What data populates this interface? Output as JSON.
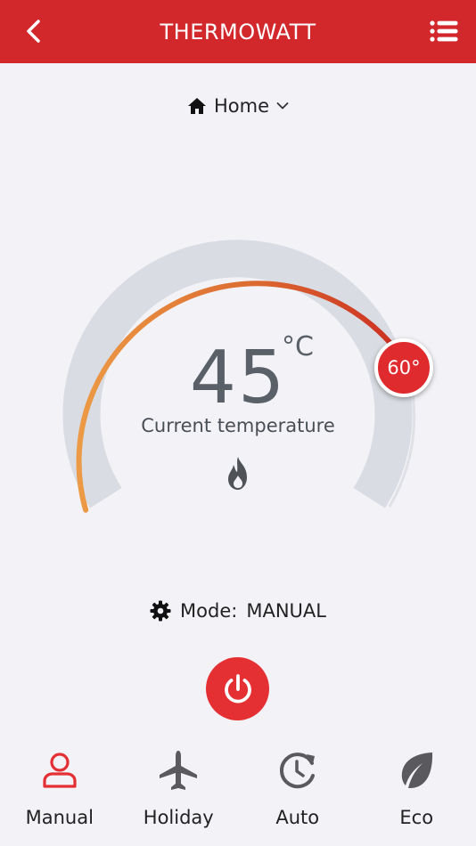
{
  "header": {
    "title": "THERMOWATT",
    "color": "#d2282c"
  },
  "location": {
    "name": "Home"
  },
  "gauge": {
    "current_temperature": "45",
    "unit": "°C",
    "caption": "Current temperature",
    "setpoint_label": "60°",
    "colors": {
      "track": "#d9dce2",
      "arc_start": "#ec9a45",
      "arc_end": "#cc2f22",
      "knob": "#e02b2e"
    }
  },
  "mode": {
    "prefix": "Mode:",
    "value": "MANUAL"
  },
  "tabs": [
    {
      "label": "Manual",
      "icon": "person-icon",
      "active": true
    },
    {
      "label": "Holiday",
      "icon": "airplane-icon",
      "active": false
    },
    {
      "label": "Auto",
      "icon": "clock-refresh-icon",
      "active": false
    },
    {
      "label": "Eco",
      "icon": "leaf-icon",
      "active": false
    }
  ],
  "colors": {
    "accent": "#e53033",
    "icon_inactive": "#5a5a5e",
    "background": "#f2f2f7"
  }
}
